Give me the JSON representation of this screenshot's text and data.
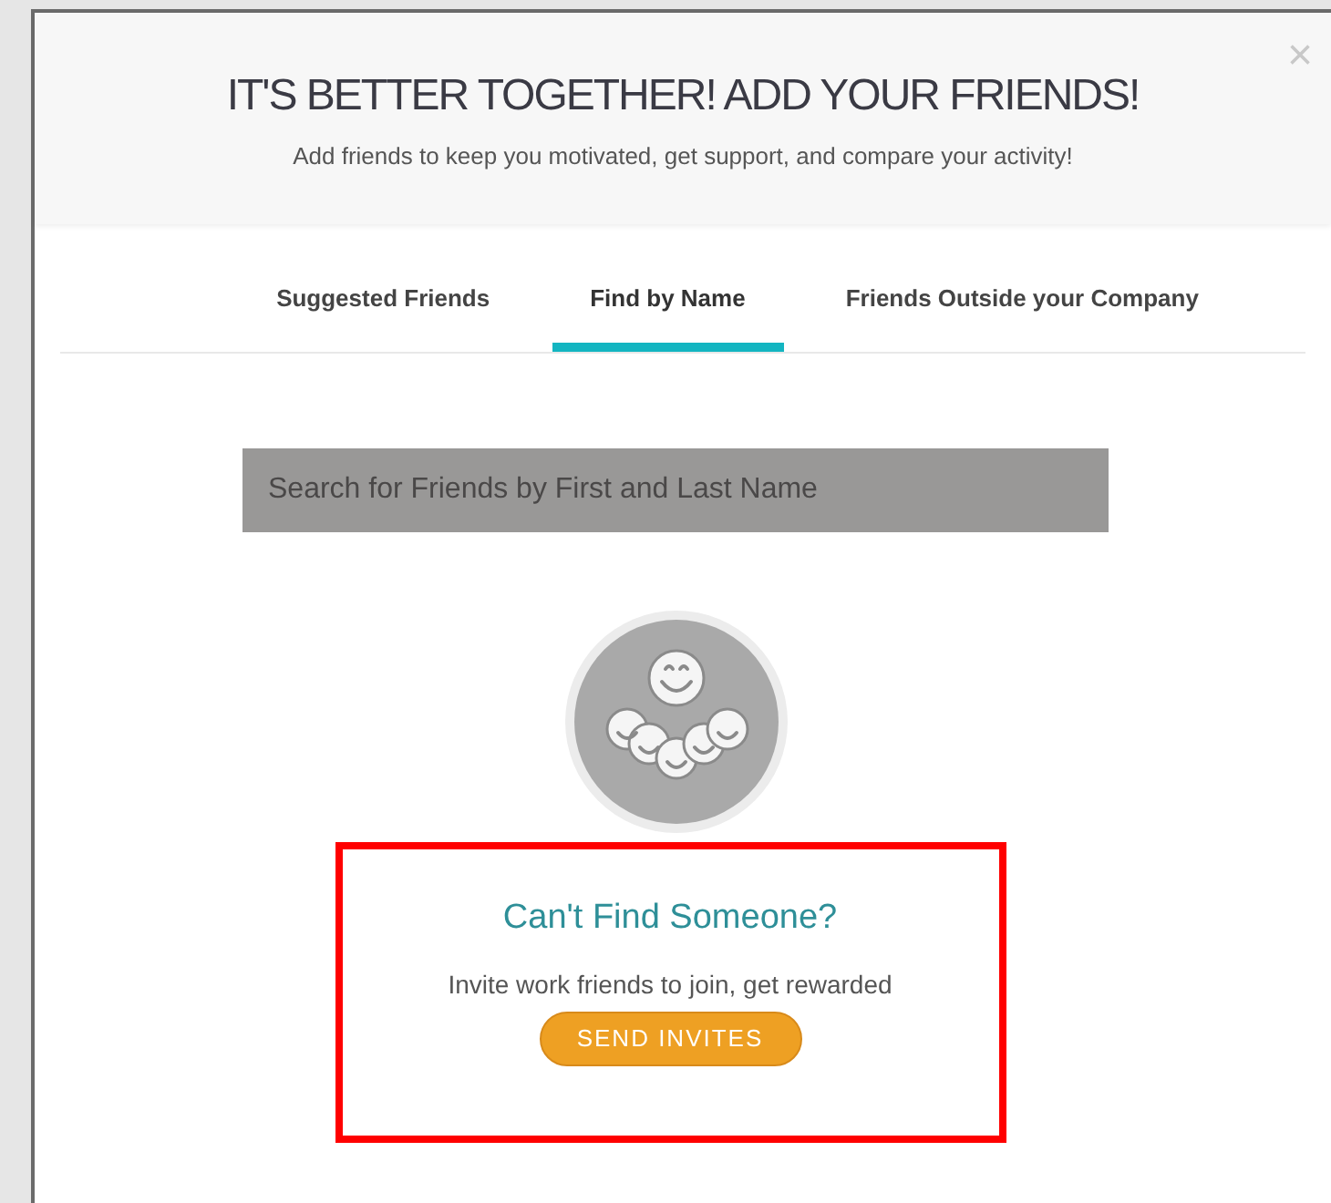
{
  "dialog": {
    "title": "IT'S BETTER TOGETHER! ADD YOUR FRIENDS!",
    "subtitle": "Add friends to keep you motivated, get support, and compare your activity!",
    "close": "×"
  },
  "tabs": [
    {
      "label": "Suggested Friends",
      "selected": false
    },
    {
      "label": "Find by Name",
      "selected": true
    },
    {
      "label": "Friends Outside your Company",
      "selected": false
    }
  ],
  "search": {
    "placeholder": "Search for Friends by First and Last Name"
  },
  "invite": {
    "highlighted": true,
    "title": "Can't Find Someone?",
    "text": "Invite work friends to join, get rewarded",
    "button": "SEND INVITES"
  }
}
